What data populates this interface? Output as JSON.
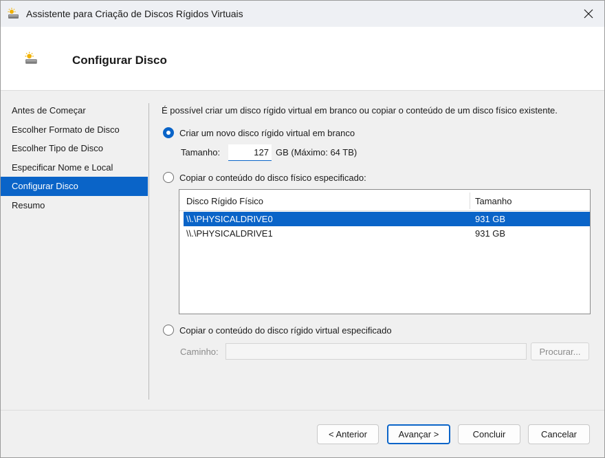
{
  "window": {
    "title": "Assistente para Criação de Discos Rígidos Virtuais",
    "close_icon": "close-icon"
  },
  "header": {
    "title": "Configurar Disco",
    "icon": "virtual-disk-icon"
  },
  "nav": {
    "items": [
      {
        "label": "Antes de Começar",
        "active": false
      },
      {
        "label": "Escolher Formato de Disco",
        "active": false
      },
      {
        "label": "Escolher Tipo de Disco",
        "active": false
      },
      {
        "label": "Especificar Nome e Local",
        "active": false
      },
      {
        "label": "Configurar Disco",
        "active": true
      },
      {
        "label": "Resumo",
        "active": false
      }
    ]
  },
  "content": {
    "intro": "É possível criar um disco rígido virtual em branco ou copiar o conteúdo de um disco físico existente.",
    "option_new": {
      "label": "Criar um novo disco rígido virtual em branco",
      "selected": true
    },
    "size": {
      "label": "Tamanho:",
      "value": "127",
      "unit_text": "GB (Máximo: 64 TB)"
    },
    "option_physical": {
      "label": "Copiar o conteúdo do disco físico especificado:",
      "selected": false
    },
    "disk_table": {
      "columns": [
        "Disco Rígido Físico",
        "Tamanho"
      ],
      "rows": [
        {
          "disk": "\\\\.\\PHYSICALDRIVE0",
          "size": "931 GB",
          "selected": true
        },
        {
          "disk": "\\\\.\\PHYSICALDRIVE1",
          "size": "931 GB",
          "selected": false
        }
      ]
    },
    "option_virtual": {
      "label": "Copiar o conteúdo do disco rígido virtual especificado",
      "selected": false
    },
    "path": {
      "label": "Caminho:",
      "value": ""
    },
    "browse_label": "Procurar..."
  },
  "footer": {
    "back_label": "< Anterior",
    "next_label": "Avançar >",
    "finish_label": "Concluir",
    "cancel_label": "Cancelar"
  },
  "colors": {
    "accent": "#0a64c8"
  }
}
